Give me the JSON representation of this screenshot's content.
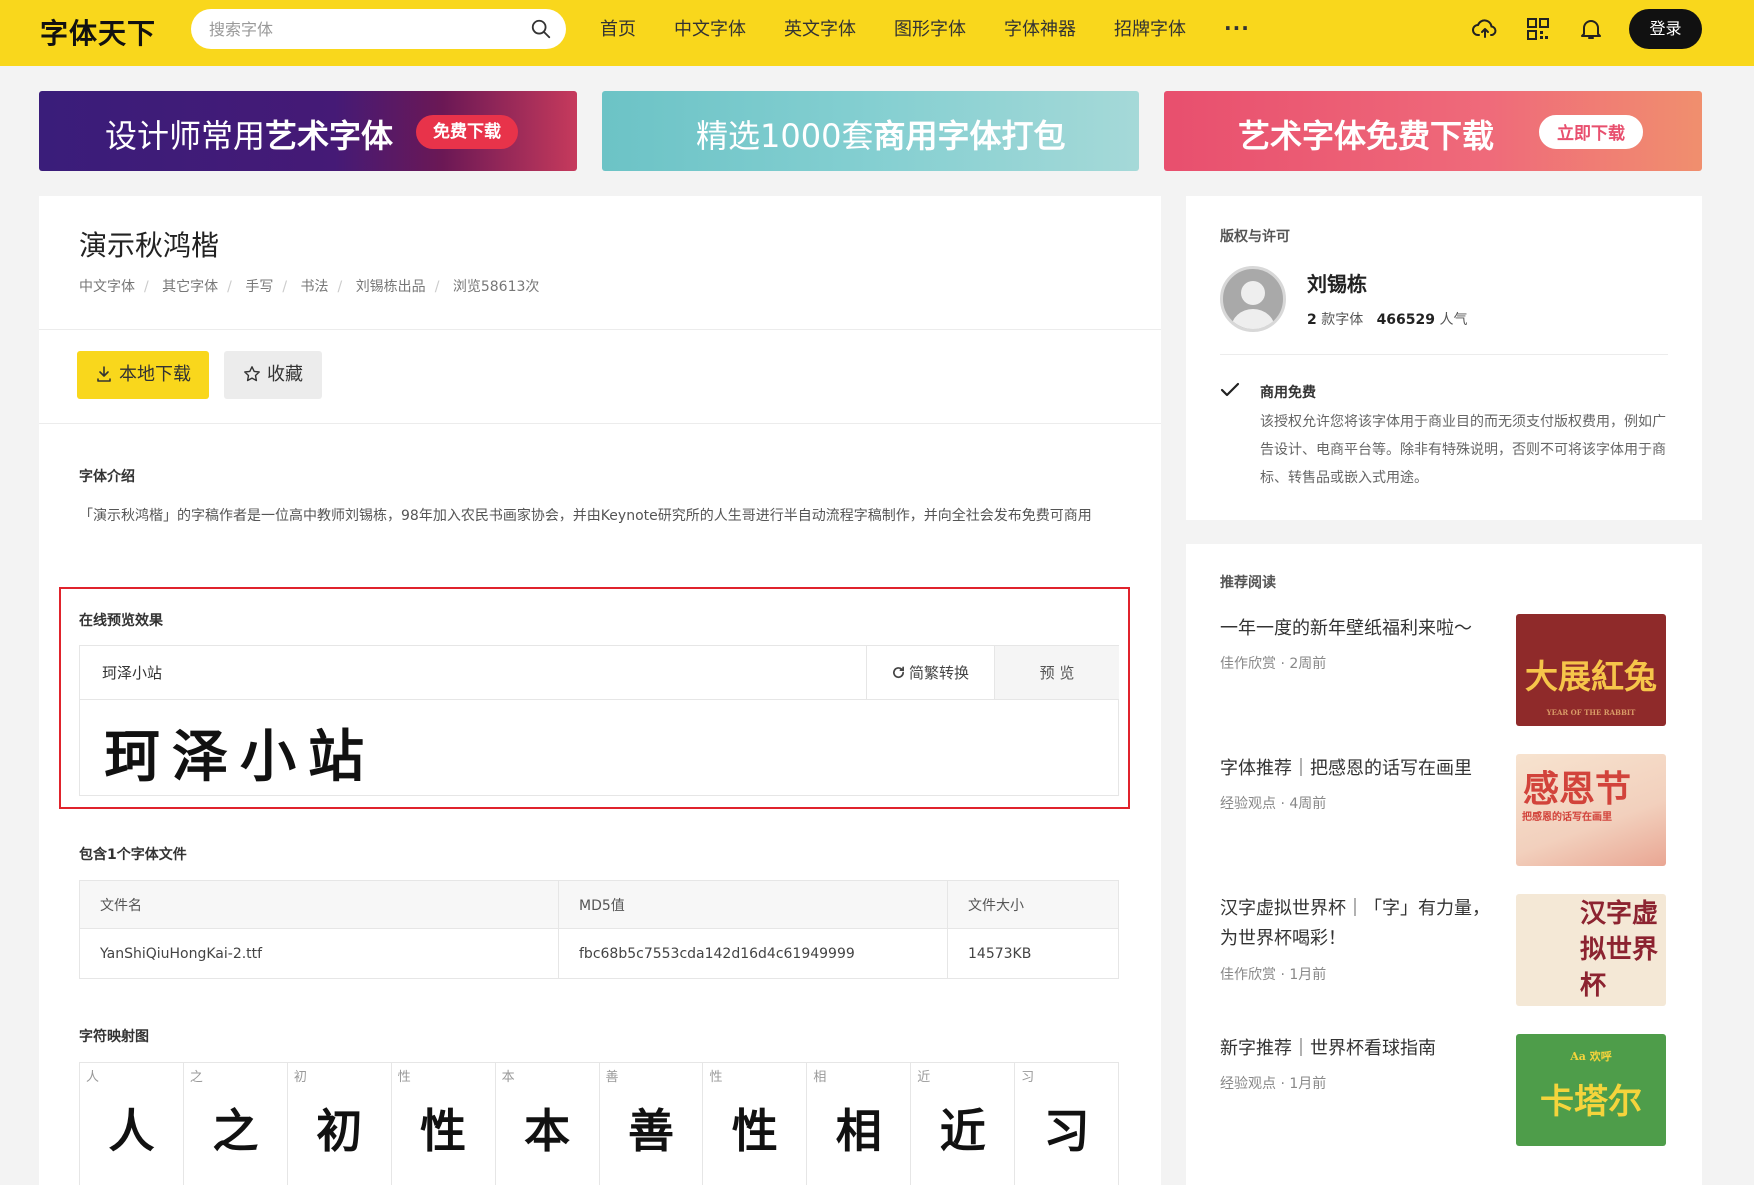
{
  "header": {
    "logo": "字体天下",
    "search_placeholder": "搜索字体",
    "nav": [
      "首页",
      "中文字体",
      "英文字体",
      "图形字体",
      "字体神器",
      "招牌字体"
    ],
    "more": "···",
    "login": "登录"
  },
  "banners": [
    {
      "text_plain": "设计师常用",
      "text_bold": "艺术字体",
      "pill": "免费下载"
    },
    {
      "text_plain": "精选1000套",
      "text_bold": "商用字体打包"
    },
    {
      "text_plain": "艺术字体免费下载",
      "pill": "立即下载"
    }
  ],
  "font": {
    "title": "演示秋鸿楷",
    "crumbs": [
      "中文字体",
      "其它字体",
      "手写",
      "书法",
      "刘锡栋出品",
      "浏览58613次"
    ],
    "download_label": "本地下载",
    "favorite_label": "收藏",
    "intro_heading": "字体介绍",
    "intro_text": "「演示秋鸿楷」的字稿作者是一位高中教师刘锡栋，98年加入农民书画家协会，并由Keynote研究所的人生哥进行半自动流程字稿制作，并向全社会发布免费可商用"
  },
  "preview": {
    "heading": "在线预览效果",
    "input_value": "珂泽小站",
    "convert_label": "简繁转换",
    "preview_label": "预 览",
    "output_text": "珂泽小站"
  },
  "files": {
    "heading": "包含1个字体文件",
    "columns": [
      "文件名",
      "MD5值",
      "文件大小"
    ],
    "rows": [
      [
        "YanShiQiuHongKai-2.ttf",
        "fbc68b5c7553cda142d16d4c61949999",
        "14573KB"
      ]
    ]
  },
  "glyph_map": {
    "heading": "字符映射图",
    "chars": [
      "人",
      "之",
      "初",
      "性",
      "本",
      "善",
      "性",
      "相",
      "近",
      "习"
    ]
  },
  "license": {
    "heading": "版权与许可",
    "author": "刘锡栋",
    "font_count": "2",
    "font_count_label": "款字体",
    "popularity": "466529",
    "popularity_label": "人气",
    "license_title": "商用免费",
    "license_text": "该授权允许您将该字体用于商业目的而无须支付版权费用，例如广告设计、电商平台等。除非有特殊说明，否则不可将该字体用于商标、转售品或嵌入式用途。"
  },
  "recommend": {
    "heading": "推荐阅读",
    "articles": [
      {
        "title": "一年一度的新年壁纸福利来啦～",
        "category": "佳作欣赏",
        "time": "2周前",
        "thumb_text": "大展紅兔",
        "thumb_sub": "YEAR OF THE RABBIT"
      },
      {
        "title": "字体推荐｜把感恩的话写在画里",
        "category": "经验观点",
        "time": "4周前",
        "thumb_text": "感恩节",
        "thumb_sub": "把感恩的话写在画里"
      },
      {
        "title": "汉字虚拟世界杯｜「字」有力量，为世界杯喝彩！",
        "category": "佳作欣赏",
        "time": "1月前",
        "thumb_text": "汉字虚拟世界杯"
      },
      {
        "title": "新字推荐｜世界杯看球指南",
        "category": "经验观点",
        "time": "1月前",
        "thumb_text": "卡塔尔",
        "thumb_sub": "Aa 欢呼"
      }
    ]
  }
}
